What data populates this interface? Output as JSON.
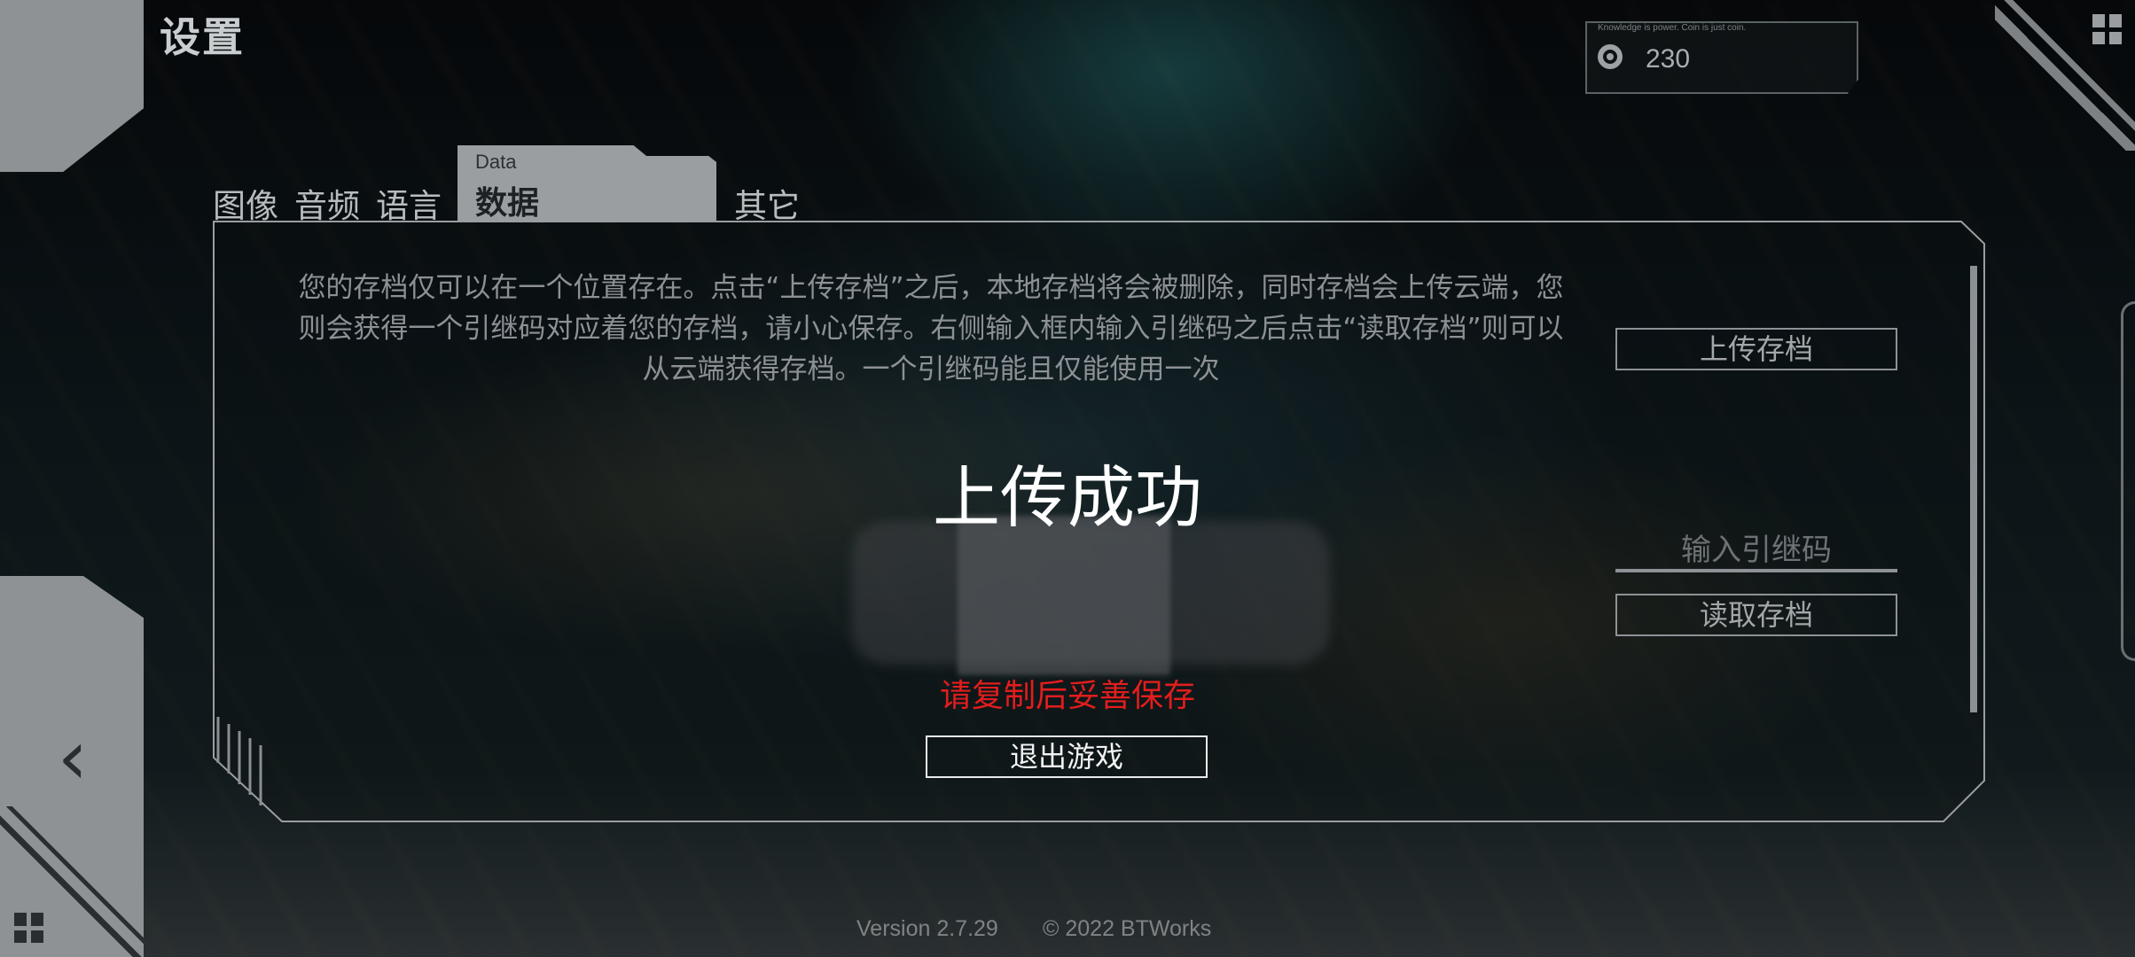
{
  "header": {
    "title": "设置"
  },
  "coins": {
    "motto": "Knowledge is power. Coin is just coin.",
    "value": "230",
    "icon": "coin-icon"
  },
  "tabs": [
    {
      "label": "图像"
    },
    {
      "label": "音频"
    },
    {
      "label": "语言"
    },
    {
      "label": "数据",
      "label_en": "Data",
      "active": true
    },
    {
      "label": "其它"
    }
  ],
  "data_panel": {
    "description": "您的存档仅可以在一个位置存在。点击“上传存档”之后，本地存档将会被删除，同时存档会上传云端，您则会获得一个引继码对应着您的存档，请小心保存。右侧输入框内输入引继码之后点击“读取存档”则可以从云端获得存档。一个引继码能且仅能使用一次",
    "upload_button": "上传存档",
    "code_input_placeholder": "输入引继码",
    "load_button": "读取存档"
  },
  "dialog": {
    "title": "上传成功",
    "notice": "请复制后妥善保存",
    "notice_color": "#e21d1d",
    "quit_button": "退出游戏"
  },
  "footer": {
    "version": "Version 2.7.29",
    "copyright": "© 2022 BTWorks"
  },
  "icons": {
    "back": "chevron-left-icon",
    "menu": "grid-menu-icon"
  }
}
